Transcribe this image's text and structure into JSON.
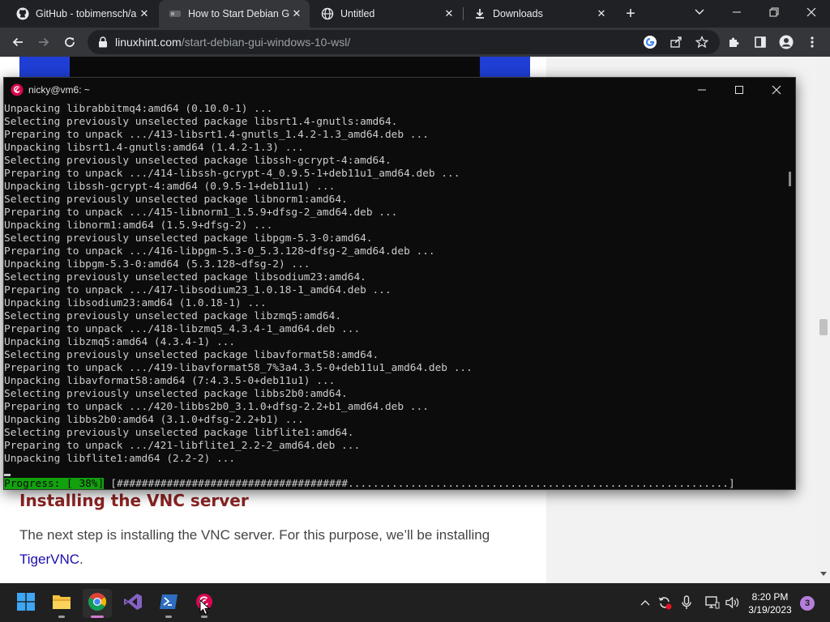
{
  "browser": {
    "tabs": [
      {
        "title": "GitHub - tobimensch/a",
        "icon": "github-icon",
        "active": false
      },
      {
        "title": "How to Start Debian GU",
        "icon": "linuxhint-icon",
        "active": true
      },
      {
        "title": "Untitled",
        "icon": "globe-icon",
        "active": false
      },
      {
        "title": "Downloads",
        "icon": "download-icon",
        "active": false
      }
    ],
    "address": {
      "domain": "linuxhint.com",
      "path": "/start-debian-gui-windows-10-wsl/"
    }
  },
  "page": {
    "heading": "Installing the VNC server",
    "paragraph_text": "The next step is installing the VNC server. For this purpose, we’ll be installing",
    "paragraph_link": "TigerVNC",
    "paragraph_end": "."
  },
  "terminal": {
    "title": "nicky@vm6: ~",
    "lines": [
      "Unpacking librabbitmq4:amd64 (0.10.0-1) ...",
      "Selecting previously unselected package libsrt1.4-gnutls:amd64.",
      "Preparing to unpack .../413-libsrt1.4-gnutls_1.4.2-1.3_amd64.deb ...",
      "Unpacking libsrt1.4-gnutls:amd64 (1.4.2-1.3) ...",
      "Selecting previously unselected package libssh-gcrypt-4:amd64.",
      "Preparing to unpack .../414-libssh-gcrypt-4_0.9.5-1+deb11u1_amd64.deb ...",
      "Unpacking libssh-gcrypt-4:amd64 (0.9.5-1+deb11u1) ...",
      "Selecting previously unselected package libnorm1:amd64.",
      "Preparing to unpack .../415-libnorm1_1.5.9+dfsg-2_amd64.deb ...",
      "Unpacking libnorm1:amd64 (1.5.9+dfsg-2) ...",
      "Selecting previously unselected package libpgm-5.3-0:amd64.",
      "Preparing to unpack .../416-libpgm-5.3-0_5.3.128~dfsg-2_amd64.deb ...",
      "Unpacking libpgm-5.3-0:amd64 (5.3.128~dfsg-2) ...",
      "Selecting previously unselected package libsodium23:amd64.",
      "Preparing to unpack .../417-libsodium23_1.0.18-1_amd64.deb ...",
      "Unpacking libsodium23:amd64 (1.0.18-1) ...",
      "Selecting previously unselected package libzmq5:amd64.",
      "Preparing to unpack .../418-libzmq5_4.3.4-1_amd64.deb ...",
      "Unpacking libzmq5:amd64 (4.3.4-1) ...",
      "Selecting previously unselected package libavformat58:amd64.",
      "Preparing to unpack .../419-libavformat58_7%3a4.3.5-0+deb11u1_amd64.deb ...",
      "Unpacking libavformat58:amd64 (7:4.3.5-0+deb11u1) ...",
      "Selecting previously unselected package libbs2b0:amd64.",
      "Preparing to unpack .../420-libbs2b0_3.1.0+dfsg-2.2+b1_amd64.deb ...",
      "Unpacking libbs2b0:amd64 (3.1.0+dfsg-2.2+b1) ...",
      "Selecting previously unselected package libflite1:amd64.",
      "Preparing to unpack .../421-libflite1_2.2-2_amd64.deb ...",
      "Unpacking libflite1:amd64 (2.2-2) ..."
    ],
    "progress_label": "Progress: [ 38%]",
    "progress_bar": "[#####################################.............................................................]",
    "progress_fraction": 0.38
  },
  "taskbar": {
    "apps": [
      "start-icon",
      "file-explorer-icon",
      "chrome-icon",
      "visual-studio-icon",
      "powershell-icon",
      "debian-icon"
    ],
    "time": "8:20 PM",
    "date": "3/19/2023",
    "notification_count": "3"
  },
  "colors": {
    "link": "#1a0dab",
    "heading": "#8b2323",
    "progress_green": "#13a10e",
    "debian_red": "#d70751",
    "vnc_blue": "#1f3fd6"
  }
}
